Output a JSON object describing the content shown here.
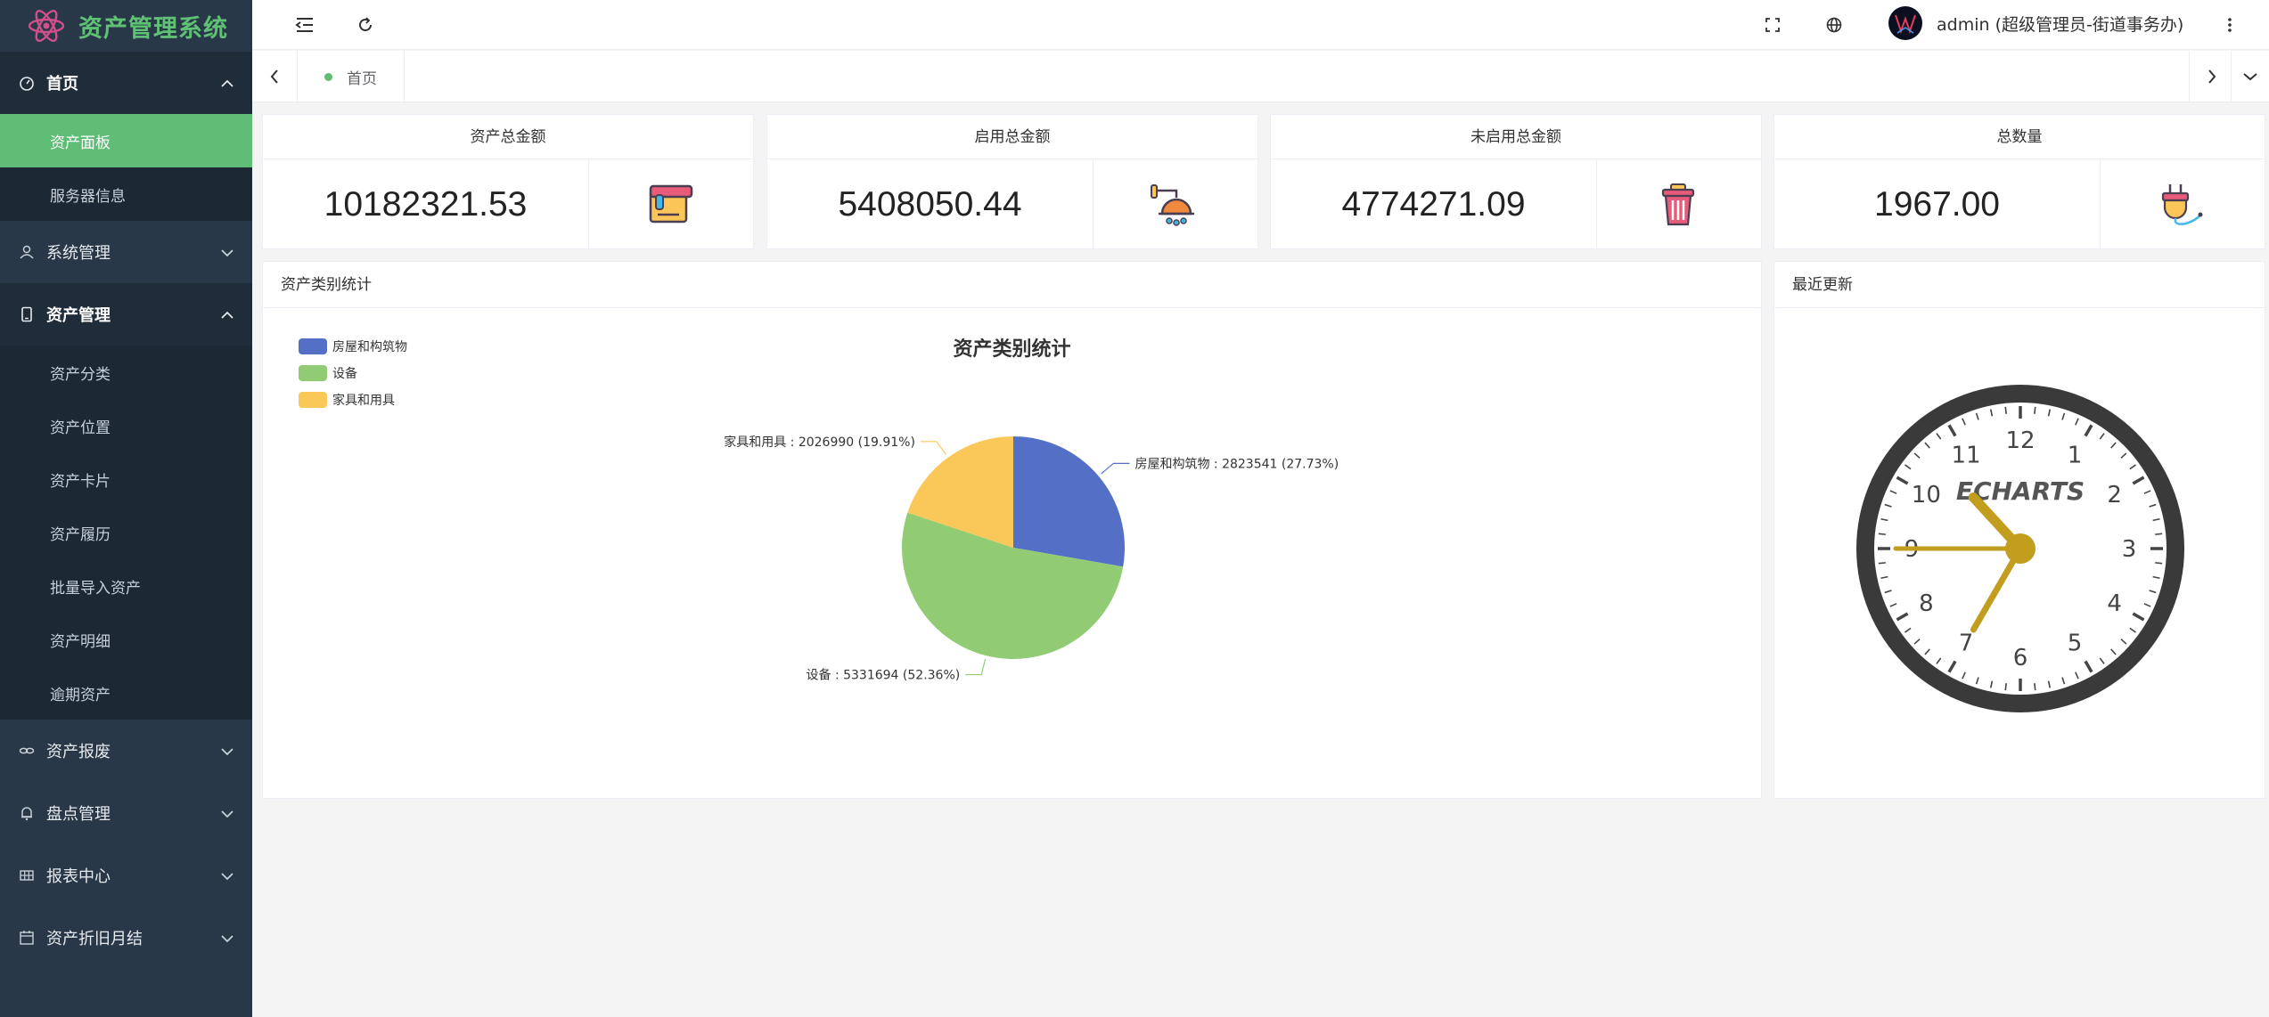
{
  "app": {
    "title": "资产管理系统"
  },
  "sidebar": {
    "groups": [
      {
        "label": "首页",
        "open": true,
        "items": [
          {
            "label": "资产面板",
            "active": true
          },
          {
            "label": "服务器信息",
            "active": false
          }
        ]
      },
      {
        "label": "系统管理",
        "open": false,
        "items": []
      },
      {
        "label": "资产管理",
        "open": true,
        "items": [
          {
            "label": "资产分类"
          },
          {
            "label": "资产位置"
          },
          {
            "label": "资产卡片"
          },
          {
            "label": "资产履历"
          },
          {
            "label": "批量导入资产"
          },
          {
            "label": "资产明细"
          },
          {
            "label": "逾期资产"
          }
        ]
      },
      {
        "label": "资产报废",
        "open": false
      },
      {
        "label": "盘点管理",
        "open": false
      },
      {
        "label": "报表中心",
        "open": false
      },
      {
        "label": "资产折旧月结",
        "open": false
      }
    ]
  },
  "header": {
    "user": "admin (超级管理员-街道事务办)"
  },
  "tabs": [
    {
      "label": "首页"
    }
  ],
  "stats": [
    {
      "title": "资产总金额",
      "value": "10182321.53",
      "icon": "paint-bucket-icon"
    },
    {
      "title": "启用总金额",
      "value": "5408050.44",
      "icon": "lamp-icon"
    },
    {
      "title": "未启用总金额",
      "value": "4774271.09",
      "icon": "trash-can-icon"
    },
    {
      "title": "总数量",
      "value": "1967.00",
      "icon": "plug-icon"
    }
  ],
  "panels": {
    "category": {
      "title": "资产类别统计"
    },
    "recent": {
      "title": "最近更新"
    }
  },
  "chart_data": {
    "type": "pie",
    "title": "资产类别统计",
    "series": [
      {
        "name": "房屋和构筑物",
        "value": 2823541,
        "percent": "27.73%",
        "color": "#5470c6"
      },
      {
        "name": "设备",
        "value": 5331694,
        "percent": "52.36%",
        "color": "#91cc75"
      },
      {
        "name": "家具和用具",
        "value": 2026990,
        "percent": "19.91%",
        "color": "#fac858"
      }
    ],
    "labels": [
      "房屋和构筑物 : 2823541 (27.73%)",
      "设备 : 5331694 (52.36%)",
      "家具和用具 : 2026990 (19.91%)"
    ],
    "legend_position": "top-left"
  },
  "clock": {
    "watermark": "ECHARTS",
    "numbers": [
      "12",
      "1",
      "2",
      "3",
      "4",
      "5",
      "6",
      "7",
      "8",
      "9",
      "10",
      "11"
    ],
    "hour": 10,
    "minute": 35,
    "second": 45,
    "hand_color": "#c29d1e"
  }
}
